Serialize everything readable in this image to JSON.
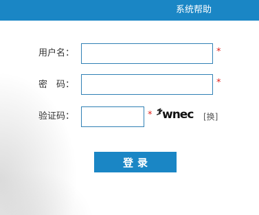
{
  "header": {
    "help_link": "系统帮助"
  },
  "form": {
    "username_label": "用户名：",
    "password_label": "密　码：",
    "captcha_label": "验证码：",
    "required_mark": "*",
    "refresh_label": "[换]",
    "captcha_text": "wnec",
    "submit_label": "登录",
    "username_value": "",
    "password_value": "",
    "captcha_value": ""
  },
  "colors": {
    "accent": "#1a86c5",
    "field_border": "#2e7fb4",
    "required": "#e0201a"
  }
}
